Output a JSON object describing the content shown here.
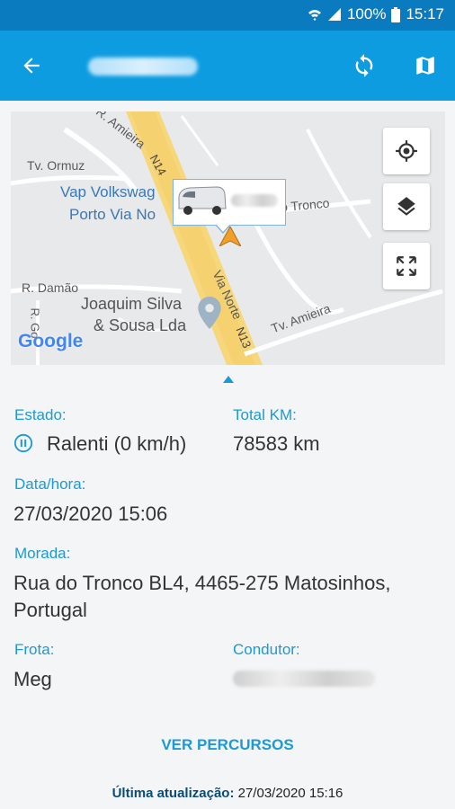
{
  "status_bar": {
    "battery": "100%",
    "time": "15:17"
  },
  "map": {
    "labels": {
      "r_amieira": "R. Amieira",
      "tv_ormuz": "Tv. Ormuz",
      "n14": "N14",
      "vap_line1": "Vap Volkswag",
      "vap_line2": "Porto Via No",
      "tronco": "o Tronco",
      "r_damao": "R. Damão",
      "r_go": "R. Go",
      "via_norte": "Via Norte",
      "n13": "N13",
      "joaquim_line1": "Joaquim Silva",
      "joaquim_line2": "& Sousa Lda",
      "tv_amieira": "Tv. Amieira",
      "google": "Google"
    }
  },
  "details": {
    "estado_label": "Estado:",
    "estado_value": "Ralenti (0 km/h)",
    "total_km_label": "Total KM:",
    "total_km_value": "78583 km",
    "datahora_label": "Data/hora:",
    "datahora_value": "27/03/2020 15:06",
    "morada_label": "Morada:",
    "morada_line1": "Rua do Tronco BL4, 4465-275 Matosinhos,",
    "morada_line2": "Portugal",
    "frota_label": "Frota:",
    "frota_value": "Meg",
    "condutor_label": "Condutor:"
  },
  "actions": {
    "ver_percursos": "VER PERCURSOS"
  },
  "footer": {
    "label": "Última atualização:",
    "value": "27/03/2020 15:16"
  },
  "colors": {
    "accent": "#0d9ce0",
    "status_bar": "#0a7bbf",
    "label_blue": "#1a9ad6"
  }
}
